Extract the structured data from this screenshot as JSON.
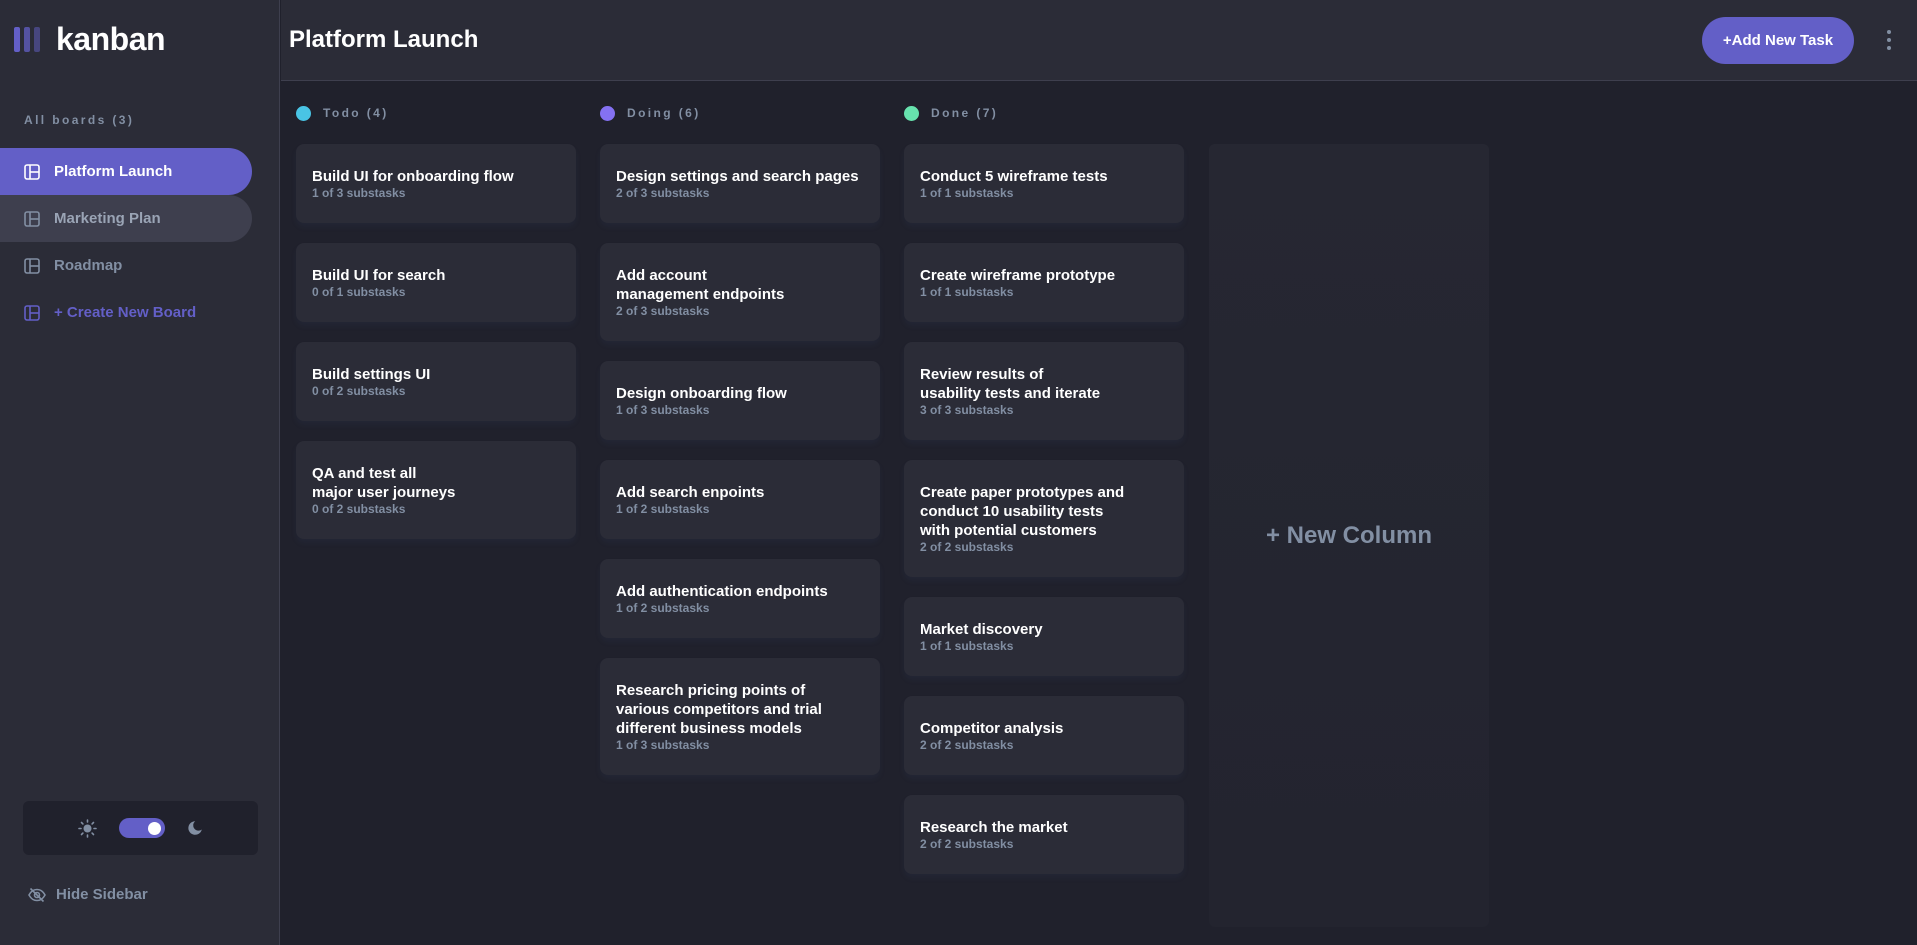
{
  "app": {
    "logo_text": "kanban"
  },
  "sidebar": {
    "boards_title": "All boards (3)",
    "boards": [
      {
        "label": "Platform Launch",
        "state": "active"
      },
      {
        "label": "Marketing Plan",
        "state": "hover"
      },
      {
        "label": "Roadmap",
        "state": "normal"
      }
    ],
    "create_board": "+ Create New Board",
    "theme": {
      "light_icon": "sun-icon",
      "dark_icon": "moon-icon",
      "mode": "dark"
    },
    "hide_sidebar": "Hide Sidebar"
  },
  "header": {
    "board_title": "Platform Launch",
    "add_task": "+Add New Task",
    "menu_icon": "vertical-ellipsis-icon"
  },
  "colors": {
    "accent": "#635fc7",
    "todo": "#49c4e5",
    "doing": "#8471f2",
    "done": "#67e2ae"
  },
  "columns": [
    {
      "name": "Todo (4)",
      "dot_color": "#49c4e5",
      "tasks": [
        {
          "title": "Build UI for onboarding flow",
          "sub": "1 of 3 substasks"
        },
        {
          "title": "Build UI for search",
          "sub": "0 of 1 substasks"
        },
        {
          "title": "Build settings UI",
          "sub": "0 of 2 substasks"
        },
        {
          "title": "QA and test all\nmajor user journeys",
          "sub": "0 of 2 substasks"
        }
      ]
    },
    {
      "name": "Doing (6)",
      "dot_color": "#8471f2",
      "tasks": [
        {
          "title": "Design settings and search pages",
          "sub": "2 of 3 substasks"
        },
        {
          "title": "Add account\nmanagement endpoints",
          "sub": "2 of 3 substasks"
        },
        {
          "title": "Design onboarding flow",
          "sub": "1 of 3 substasks"
        },
        {
          "title": "Add search enpoints",
          "sub": "1 of 2 substasks"
        },
        {
          "title": "Add authentication endpoints",
          "sub": "1 of 2 substasks"
        },
        {
          "title": "Research pricing points of\nvarious competitors and trial\ndifferent business models",
          "sub": "1 of 3 substasks"
        }
      ]
    },
    {
      "name": "Done (7)",
      "dot_color": "#67e2ae",
      "tasks": [
        {
          "title": "Conduct 5 wireframe tests",
          "sub": "1 of 1 substasks"
        },
        {
          "title": "Create wireframe prototype",
          "sub": "1 of 1 substasks"
        },
        {
          "title": "Review results of\nusability tests and iterate",
          "sub": "3 of 3 substasks"
        },
        {
          "title": "Create paper prototypes and\nconduct 10 usability tests\nwith potential customers",
          "sub": "2 of 2 substasks"
        },
        {
          "title": "Market discovery",
          "sub": "1 of 1 substasks"
        },
        {
          "title": "Competitor analysis",
          "sub": "2 of 2 substasks"
        },
        {
          "title": "Research the market",
          "sub": "2 of 2 substasks"
        }
      ]
    }
  ],
  "new_column": "+ New Column"
}
